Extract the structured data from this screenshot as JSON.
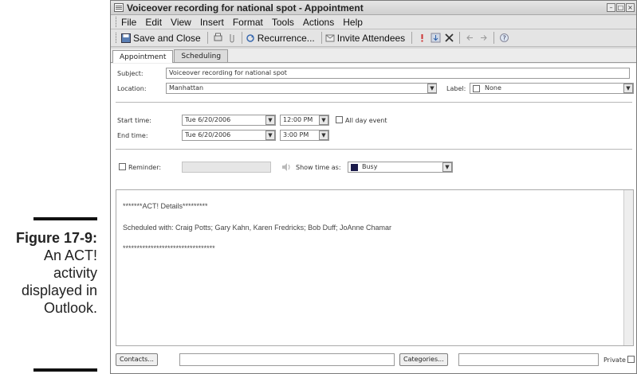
{
  "caption": {
    "figure": "Figure 17-9:",
    "lines": [
      "An ACT!",
      "activity",
      "displayed in",
      "Outlook."
    ]
  },
  "window": {
    "title": "Voiceover recording for national spot - Appointment",
    "controls": [
      "minimize-icon",
      "restore-icon",
      "close-icon"
    ]
  },
  "menu": [
    "File",
    "Edit",
    "View",
    "Insert",
    "Format",
    "Tools",
    "Actions",
    "Help"
  ],
  "toolbar": {
    "save_close": "Save and Close",
    "recurrence": "Recurrence...",
    "invite": "Invite Attendees"
  },
  "tabs": [
    "Appointment",
    "Scheduling"
  ],
  "form": {
    "subject_label": "Subject:",
    "subject_value": "Voiceover recording for national spot",
    "location_label": "Location:",
    "location_value": "Manhattan",
    "label_label": "Label:",
    "label_value": "None",
    "start_label": "Start time:",
    "start_date": "Tue 6/20/2006",
    "start_time": "12:00 PM",
    "allday_label": "All day event",
    "end_label": "End time:",
    "end_date": "Tue 6/20/2006",
    "end_time": "3:00 PM",
    "reminder_label": "Reminder:",
    "showtime_label": "Show time as:",
    "showtime_value": "Busy"
  },
  "notes": {
    "line1": "*******ACT! Details*********",
    "line2": "Scheduled with:  Craig Potts; Gary Kahn, Karen Fredricks; Bob Duff; JoAnne Chamar",
    "line3": "*********************************"
  },
  "bottom": {
    "contacts": "Contacts...",
    "categories": "Categories...",
    "private": "Private"
  }
}
